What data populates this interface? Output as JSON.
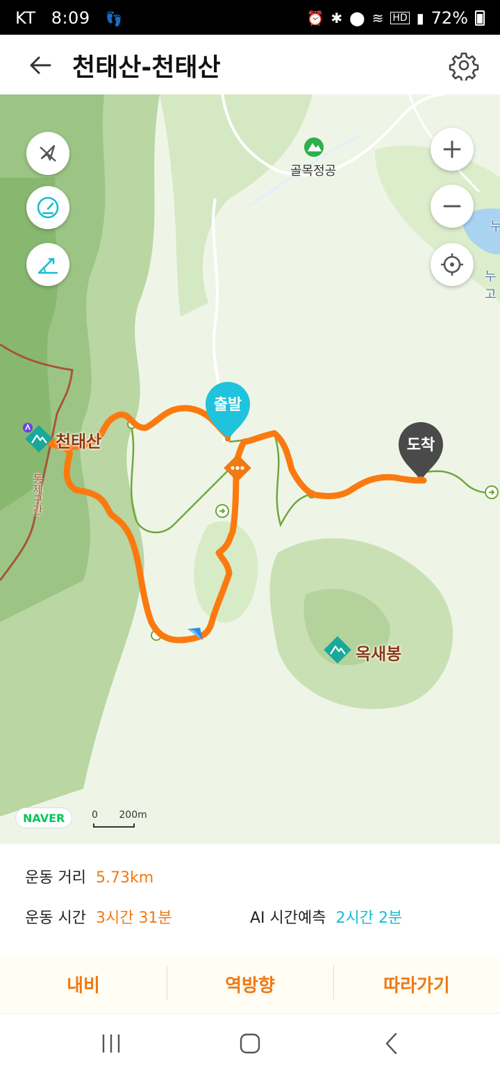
{
  "status_bar": {
    "carrier": "KT",
    "time": "8:09",
    "battery": "72%",
    "icons": [
      "step-counter-icon",
      "alarm-icon",
      "bluetooth-icon",
      "location-icon",
      "wifi-icon",
      "hd-icon",
      "signal-icon",
      "battery-icon"
    ]
  },
  "header": {
    "title": "천태산-천태산",
    "back_icon": "arrow-left-icon",
    "settings_icon": "gear-icon"
  },
  "map": {
    "controls_left": [
      "compass-off-icon",
      "speedometer-icon",
      "elevation-icon"
    ],
    "controls_right": [
      "zoom-in-icon",
      "zoom-out-icon",
      "locate-icon"
    ],
    "labels": {
      "peak_cheontaesan": "천태산",
      "peak_oksaebong": "옥새봉",
      "trailhead": "골목정공",
      "restricted_area": "통제구간",
      "edge_label_1": "누",
      "edge_label_2": "누고"
    },
    "start_pin": "출발",
    "end_pin": "도착",
    "attribution": "NAVER",
    "scale": {
      "zero": "0",
      "distance": "200m"
    },
    "colors": {
      "route": "#fb7a10",
      "start_pin": "#1fc3dc",
      "end_pin": "#4a4a4a",
      "trail": "#6fa63c",
      "boundary": "#a8543a"
    }
  },
  "info": {
    "distance_label": "운동 거리",
    "distance_value": "5.73km",
    "time_label": "운동 시간",
    "time_value": "3시간 31분",
    "ai_label": "AI 시간예측",
    "ai_value": "2시간 2분"
  },
  "actions": {
    "navigate": "내비",
    "reverse": "역방향",
    "follow": "따라가기"
  },
  "navbar": {
    "recent_icon": "recent-apps-icon",
    "home_icon": "home-icon",
    "back_icon": "back-chevron-icon"
  }
}
